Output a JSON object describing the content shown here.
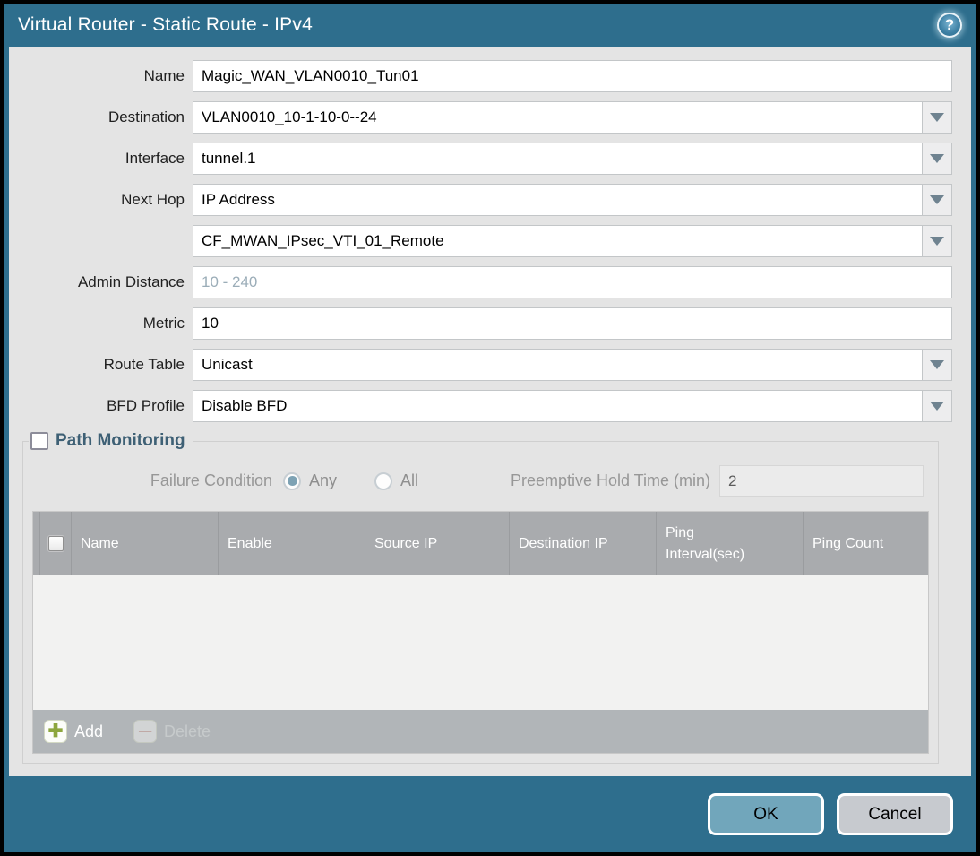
{
  "window": {
    "title": "Virtual Router - Static Route - IPv4",
    "help_icon_glyph": "?"
  },
  "colors": {
    "accent_teal": "#2e6e8d",
    "body_gray": "#e4e4e4",
    "table_header_gray": "#a9abae",
    "ok_button": "#71a6bb",
    "cancel_button": "#c7cacf",
    "add_icon_green": "#8da63d",
    "delete_icon_red": "#b3786f"
  },
  "form": {
    "rows": [
      {
        "label": "Name",
        "value": "Magic_WAN_VLAN0010_Tun01",
        "control": "text"
      },
      {
        "label": "Destination",
        "value": "VLAN0010_10-1-10-0--24",
        "control": "dropdown"
      },
      {
        "label": "Interface",
        "value": "tunnel.1",
        "control": "dropdown"
      },
      {
        "label": "Next Hop",
        "value": "IP Address",
        "control": "dropdown"
      },
      {
        "label": "",
        "value": "CF_MWAN_IPsec_VTI_01_Remote",
        "control": "dropdown"
      },
      {
        "label": "Admin Distance",
        "value": "",
        "placeholder": "10 - 240",
        "control": "text"
      },
      {
        "label": "Metric",
        "value": "10",
        "control": "text"
      },
      {
        "label": "Route Table",
        "value": "Unicast",
        "control": "dropdown"
      },
      {
        "label": "BFD Profile",
        "value": "Disable BFD",
        "control": "dropdown"
      }
    ]
  },
  "path_monitoring": {
    "title": "Path Monitoring",
    "checked": false,
    "failure_condition": {
      "label": "Failure Condition",
      "options": [
        {
          "label": "Any",
          "selected": true
        },
        {
          "label": "All",
          "selected": false
        }
      ]
    },
    "preemptive_hold_time": {
      "label": "Preemptive Hold Time (min)",
      "value": "2"
    },
    "table": {
      "columns": [
        "Name",
        "Enable",
        "Source IP",
        "Destination IP",
        "Ping Interval(sec)",
        "Ping Count"
      ],
      "rows": []
    },
    "toolbar": {
      "add_label": "Add",
      "delete_label": "Delete"
    }
  },
  "footer": {
    "ok_label": "OK",
    "cancel_label": "Cancel"
  }
}
